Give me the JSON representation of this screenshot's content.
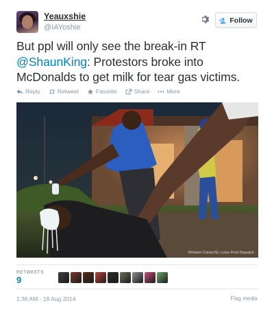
{
  "user": {
    "display_name": "Yeauxshie",
    "screen_name": "@IAYoshie"
  },
  "header": {
    "follow_label": "Follow",
    "settings_icon": "gear-icon",
    "follow_icon": "add-user-icon"
  },
  "tweet": {
    "text_before": "But ppl will only see the break-in RT ",
    "mention": "@ShaunKing",
    "text_after": ": Protestors broke into McDonalds to get milk for tear gas victims."
  },
  "actions": [
    {
      "label": "Reply",
      "icon": "reply-icon"
    },
    {
      "label": "Retweet",
      "icon": "retweet-icon"
    },
    {
      "label": "Favorite",
      "icon": "star-icon"
    },
    {
      "label": "Share",
      "icon": "share-icon"
    },
    {
      "label": "More",
      "icon": "ellipsis-icon"
    }
  ],
  "media": {
    "credit": "©Robert Cohen/St. Louis Post-Dispatch"
  },
  "stats": {
    "retweets_label": "RETWEETS",
    "retweets_count": "9",
    "avatar_colors": [
      "#3a3f45",
      "#7a3a2e",
      "#5a2a1e",
      "#b8433a",
      "#2f2a28",
      "#6b6f58",
      "#8f8f8f",
      "#c94c7a",
      "#6fa86a"
    ]
  },
  "footer": {
    "timestamp": "1:36 AM - 18 Aug 2014",
    "flag_label": "Flag media"
  },
  "colors": {
    "link": "#0084b4",
    "muted": "#8899a6",
    "text": "#292f33"
  }
}
